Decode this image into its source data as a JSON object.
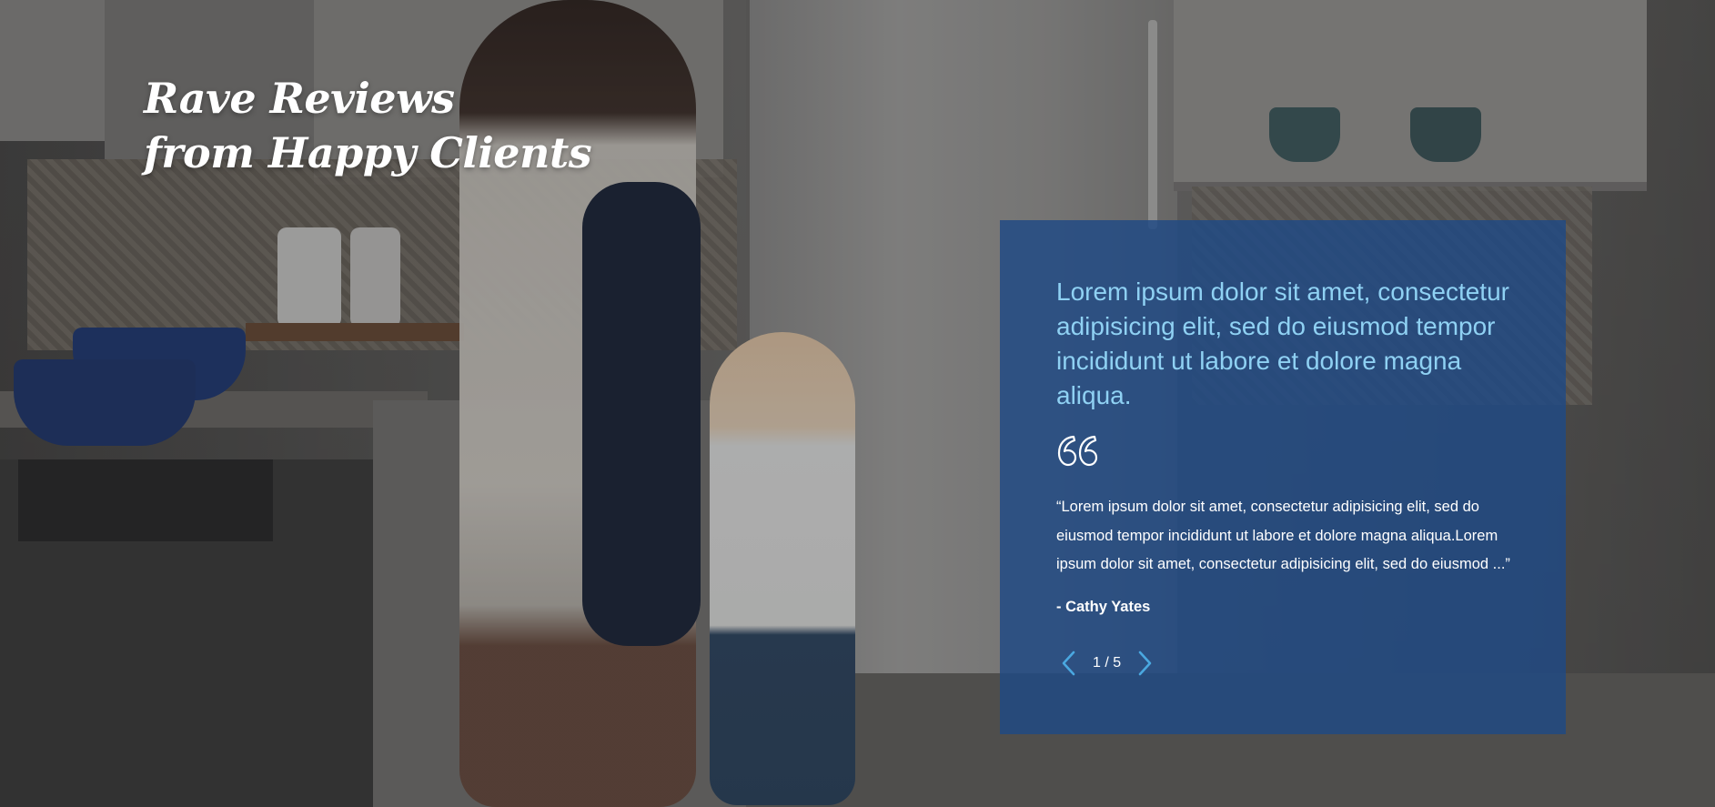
{
  "section": {
    "title_line1": "Rave Reviews",
    "title_line2": "from Happy Clients"
  },
  "testimonial": {
    "headline": "Lorem ipsum dolor sit amet, consectetur adipisicing elit, sed do eiusmod tempor incididunt ut labore et dolore magna aliqua.",
    "quote": "“Lorem ipsum dolor sit amet, consectetur adipisicing elit, sed do eiusmod tempor incididunt ut labore et dolore magna aliqua.Lorem ipsum dolor sit amet, consectetur adipisicing elit, sed do eiusmod ...”",
    "author": "- Cathy Yates",
    "quote_icon": "quote-icon"
  },
  "pager": {
    "counter": "1 / 5",
    "prev_icon": "chevron-left-icon",
    "next_icon": "chevron-right-icon"
  },
  "colors": {
    "card_background": "#1f4985",
    "headline": "#8fd1f3",
    "arrow": "#4aa8e0",
    "text": "#ffffff"
  }
}
